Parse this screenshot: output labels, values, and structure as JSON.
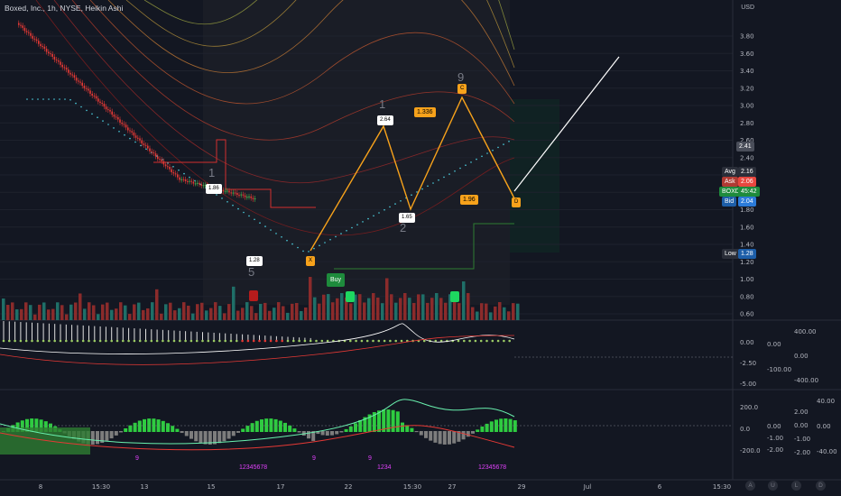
{
  "header": {
    "title": "Boxed, Inc., 1h, NYSE, Heikin Ashi"
  },
  "price_axis": {
    "currency": "USD",
    "ticks": [
      "3.80",
      "3.60",
      "3.40",
      "3.20",
      "3.00",
      "2.80",
      "2.60",
      "2.40",
      "2.20",
      "2.00",
      "1.80",
      "1.60",
      "1.40",
      "1.20",
      "1.00",
      "0.80",
      "0.60"
    ],
    "tick_values": [
      3.8,
      3.6,
      3.4,
      3.2,
      3.0,
      2.8,
      2.6,
      2.4,
      2.2,
      2.0,
      1.8,
      1.6,
      1.4,
      1.2,
      1.0,
      0.8,
      0.6
    ]
  },
  "price_labels": {
    "current": "2.41",
    "avg_label": "Avg",
    "avg_value": "2.16",
    "ask_label": "Ask",
    "ask_value": "2.06",
    "symbol_label": "BOXD",
    "symbol_value": "45:42",
    "bid_label": "Bid",
    "bid_value": "2.04",
    "low_label": "Low",
    "low_value": "1.28"
  },
  "osc1_axis": {
    "left_ticks": [
      "0.00",
      "-2.50",
      "-5.00"
    ],
    "mid_ticks": [
      "0.00",
      "-100.00"
    ],
    "right_ticks": [
      "400.00",
      "0.00",
      "-400.00"
    ]
  },
  "osc2_axis": {
    "left_ticks": [
      "200.0",
      "0.0",
      "-200.0"
    ],
    "mid_ticks": [
      "0.00",
      "-1.00",
      "-2.00"
    ],
    "right_ticks": [
      "2.00",
      "0.00",
      "-1.00",
      "-2.00"
    ],
    "far_ticks": [
      "40.00",
      "0.00",
      "-40.00"
    ]
  },
  "time_axis": {
    "labels": [
      "8",
      "15:30",
      "13",
      "15",
      "17",
      "22",
      "15:30",
      "27",
      "29",
      "Jul",
      "6",
      "15:30"
    ]
  },
  "annotations": {
    "left_top": "1.86",
    "left_bottom": "1.28",
    "count_5": "5",
    "count_1a": "1",
    "mid_top": "2.64",
    "mid_bottom": "1.65",
    "count_1b": "1",
    "count_2": "2",
    "ratio": "1.336",
    "right_low": "1.96",
    "count_9": "9",
    "pt_x": "X",
    "pt_a": "A",
    "pt_b": "B",
    "pt_c": "C",
    "pt_d": "D",
    "buy": "Buy",
    "seq_bottom_a": "12345678",
    "seq_bottom_b": "1234",
    "seq_bottom_c": "12345678",
    "nine_a": "9",
    "nine_b": "9",
    "nine_c": "9"
  },
  "bottom_buttons": [
    "A",
    "U",
    "L",
    "D"
  ],
  "colors": {
    "bg": "#131722",
    "bull": "#26a69a",
    "bear": "#ef5350",
    "pattern": "#f7a21b",
    "ask": "#e8473f",
    "bid": "#2b7bd9",
    "sym": "#1e8b3c"
  }
}
